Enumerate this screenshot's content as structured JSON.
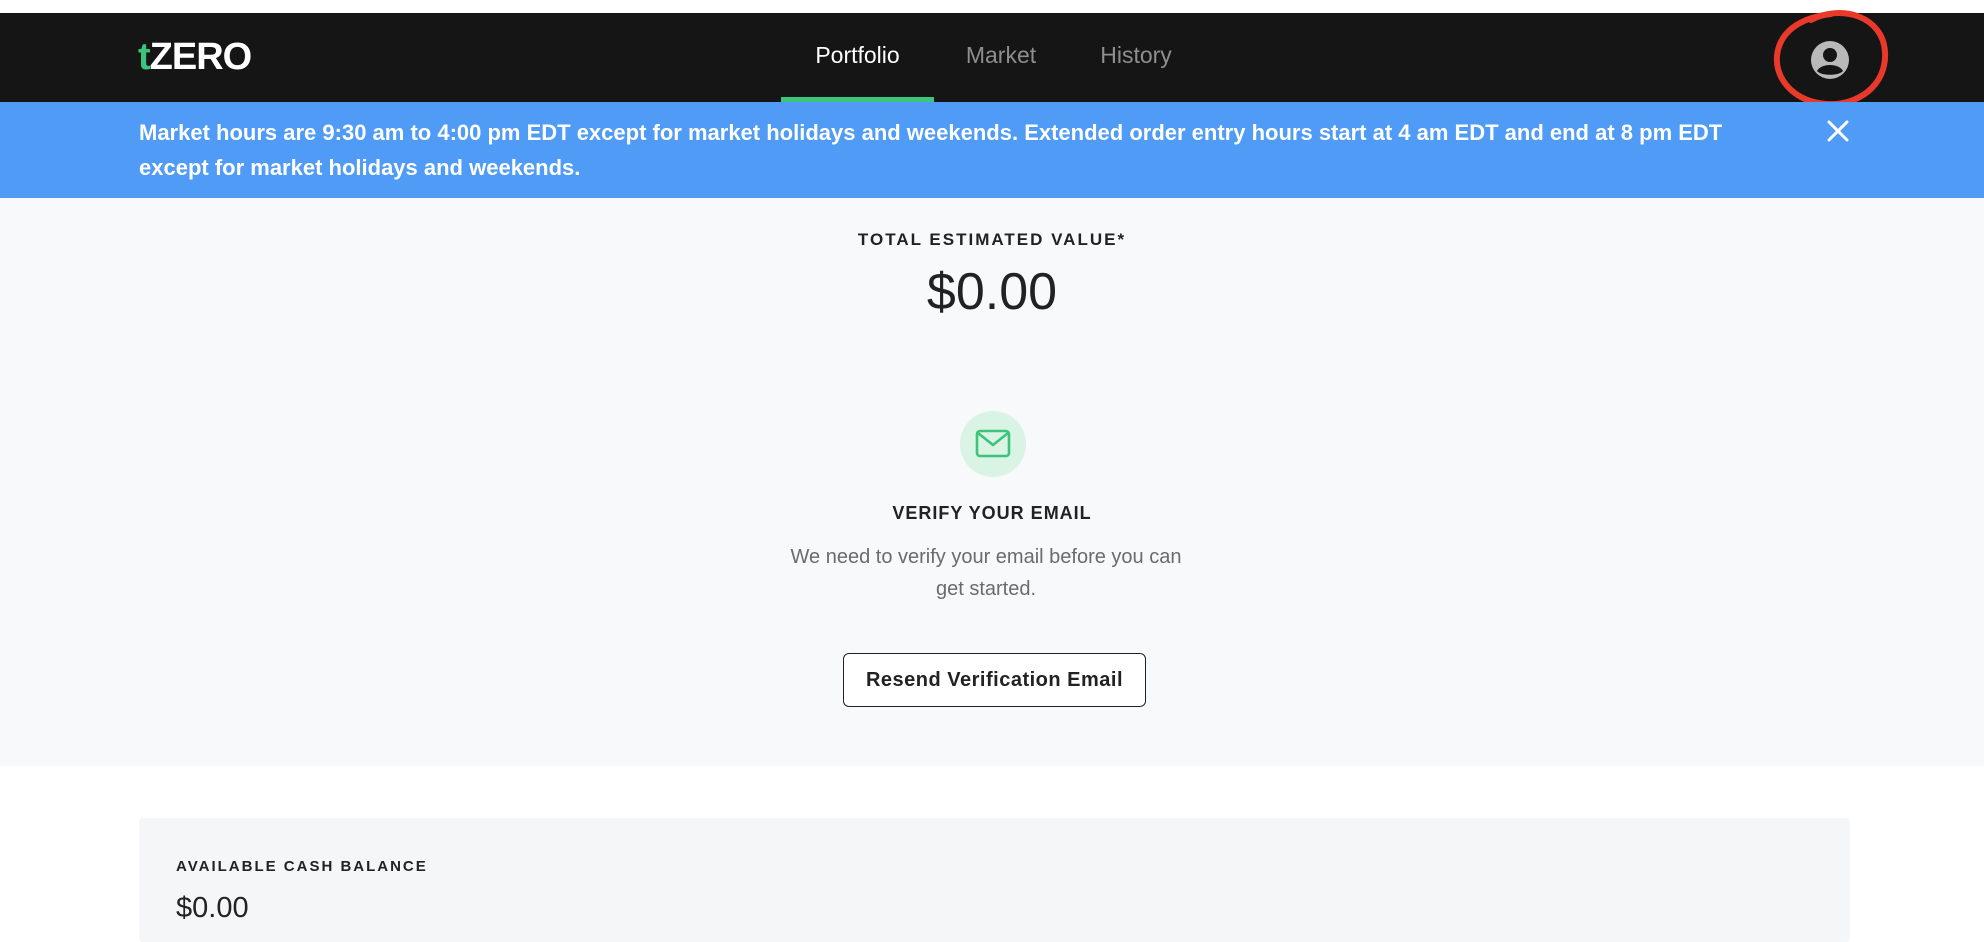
{
  "brand": {
    "logo_prefix": "t",
    "logo_main": "ZERO",
    "accent_color": "#3cc47a"
  },
  "nav": {
    "tabs": [
      {
        "label": "Portfolio",
        "active": true
      },
      {
        "label": "Market",
        "active": false
      },
      {
        "label": "History",
        "active": false
      }
    ],
    "profile_icon": "account-circle-icon",
    "highlight_color": "#e8392a"
  },
  "banner": {
    "message": "Market hours are 9:30 am to 4:00 pm EDT except for market holidays and weekends. Extended order entry hours start at 4 am EDT and end at 8 pm EDT except for market holidays and weekends.",
    "close_icon": "close-icon",
    "color": "#4f9bf5"
  },
  "portfolio": {
    "total_label": "TOTAL ESTIMATED VALUE*",
    "total_value": "$0.00"
  },
  "verify": {
    "icon": "mail-icon",
    "title": "VERIFY YOUR EMAIL",
    "message": "We need to verify your email before you can get started.",
    "button_label": "Resend Verification Email"
  },
  "cash": {
    "label": "AVAILABLE CASH BALANCE",
    "value": "$0.00"
  }
}
